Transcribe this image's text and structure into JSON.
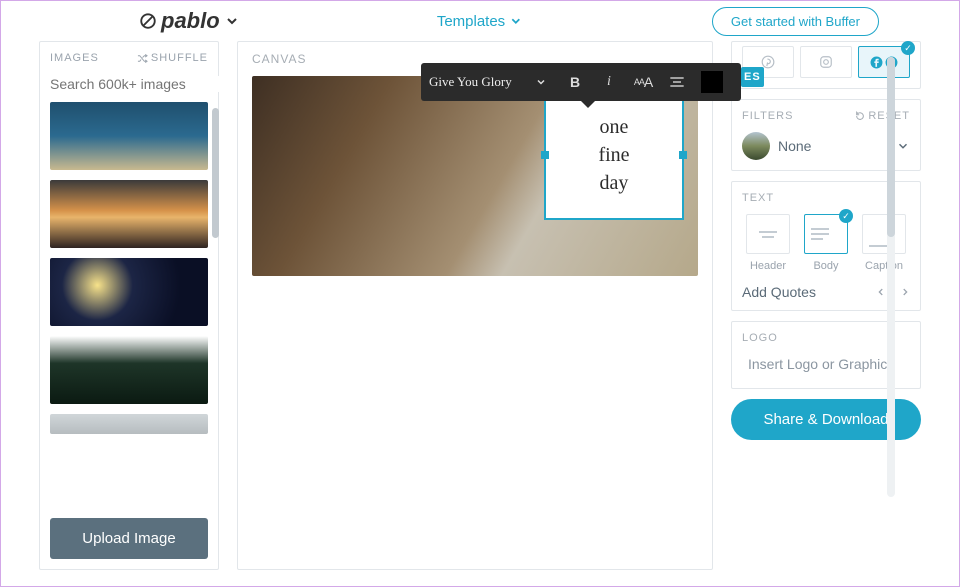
{
  "header": {
    "logo": "pablo",
    "templates_label": "Templates",
    "cta": "Get started with Buffer"
  },
  "sidebar": {
    "title": "IMAGES",
    "shuffle": "SHUFFLE",
    "search_placeholder": "Search 600k+ images",
    "upload": "Upload Image"
  },
  "canvas": {
    "label": "CANVAS",
    "text_lines": [
      "one",
      "fine",
      "day"
    ]
  },
  "toolbar": {
    "font": "Give You Glory",
    "bold": "B",
    "italic": "i"
  },
  "sizes_tag": "ES",
  "filters": {
    "label": "FILTERS",
    "reset": "RESET",
    "current": "None"
  },
  "text": {
    "label": "TEXT",
    "options": [
      "Header",
      "Body",
      "Caption"
    ],
    "add_quotes": "Add Quotes"
  },
  "logo": {
    "label": "LOGO",
    "insert": "Insert Logo or Graphic"
  },
  "share": "Share & Download"
}
